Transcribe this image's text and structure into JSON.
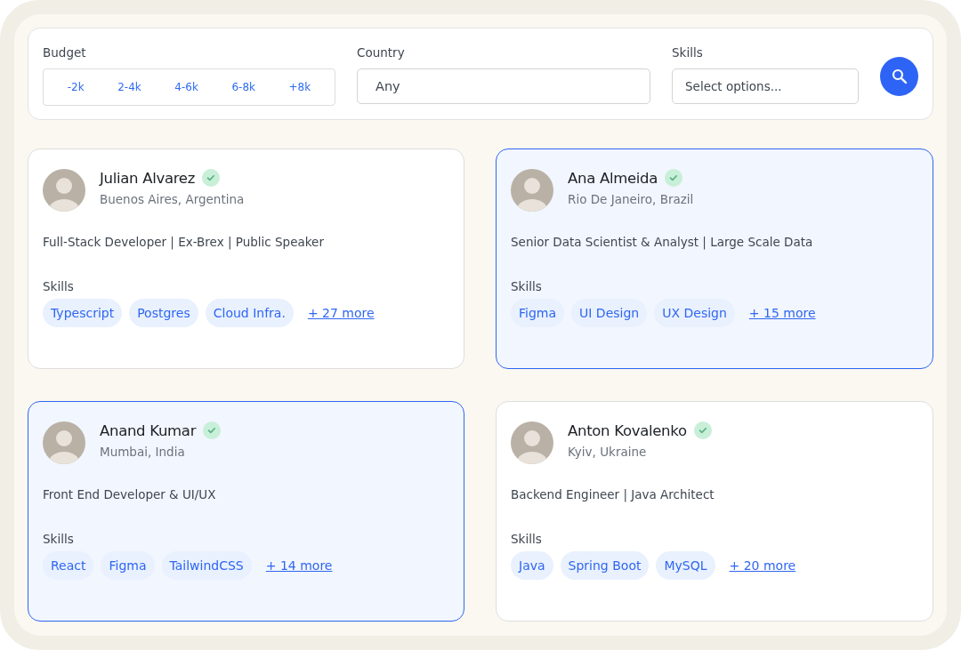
{
  "filters": {
    "budget": {
      "label": "Budget",
      "options": [
        "-2k",
        "2-4k",
        "4-6k",
        "6-8k",
        "+8k"
      ]
    },
    "country": {
      "label": "Country",
      "value": "Any"
    },
    "skills": {
      "label": "Skills",
      "placeholder": "Select options..."
    }
  },
  "profiles": [
    {
      "name": "Julian Alvarez",
      "verified": true,
      "location": "Buenos Aires, Argentina",
      "headline": "Full-Stack Developer | Ex-Brex | Public Speaker",
      "skills_label": "Skills",
      "skills": [
        "Typescript",
        "Postgres",
        "Cloud Infra."
      ],
      "more": "+ 27 more",
      "selected": false
    },
    {
      "name": "Ana Almeida",
      "verified": true,
      "location": "Rio De Janeiro, Brazil",
      "headline": "Senior Data Scientist & Analyst | Large Scale Data",
      "skills_label": "Skills",
      "skills": [
        "Figma",
        "UI Design",
        "UX Design"
      ],
      "more": "+ 15 more",
      "selected": true
    },
    {
      "name": "Anand Kumar",
      "verified": true,
      "location": "Mumbai, India",
      "headline": "Front End Developer & UI/UX",
      "skills_label": "Skills",
      "skills": [
        "React",
        "Figma",
        "TailwindCSS"
      ],
      "more": "+ 14 more",
      "selected": true
    },
    {
      "name": "Anton Kovalenko",
      "verified": true,
      "location": "Kyiv, Ukraine",
      "headline": "Backend Engineer | Java Architect",
      "skills_label": "Skills",
      "skills": [
        "Java",
        "Spring Boot",
        "MySQL"
      ],
      "more": "+ 20 more",
      "selected": false
    }
  ]
}
